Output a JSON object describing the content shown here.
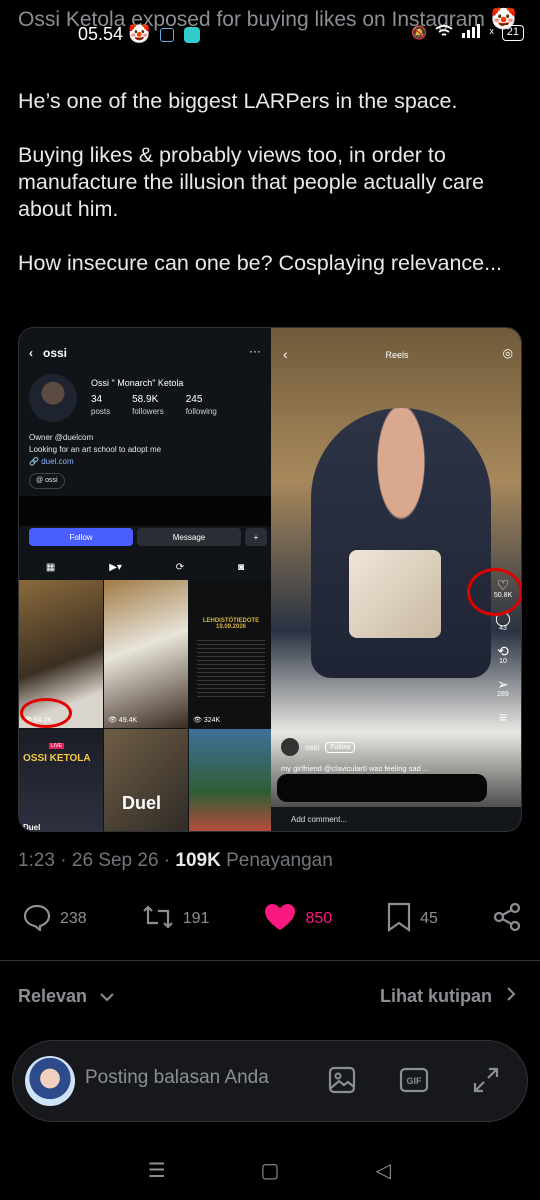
{
  "status_bar": {
    "time": "05.54",
    "battery": "21",
    "network": "ˣ"
  },
  "scrolled_title": "Ossi Ketola exposed for buying likes on Instagram 🤡",
  "tweet": {
    "text": "He’s one of the biggest LARPers in the space.\n\nBuying likes & probably views too, in order to manufacture the illusion that people actually care about him.\n\nHow insecure can one be? Cosplaying relevance..."
  },
  "instagram": {
    "username": "ossi",
    "display_name": "Ossi \" Monarch\" Ketola",
    "stats": [
      {
        "value": "34",
        "label": "posts"
      },
      {
        "value": "58.9K",
        "label": "followers"
      },
      {
        "value": "245",
        "label": "following"
      }
    ],
    "bio_line1": "Owner @duelcom",
    "bio_line2": "Looking for an art school to adopt me",
    "link": "duel.com",
    "threads_chip": "ossi",
    "follow_label": "Follow",
    "message_label": "Message",
    "grid_views": [
      "64.3K",
      "49.4K",
      "324K"
    ],
    "news_title": "LEHDISTÖTIEDOTE 19.09.2026",
    "ossi_label": "OSSI KETOLA",
    "live_label": "LIVE",
    "duel_small": "Duel",
    "duel_big": "Duel"
  },
  "reel": {
    "title": "Reels",
    "likes": "50.8K",
    "comments": "43",
    "reposts": "10",
    "shares": "289",
    "username": "ossi",
    "follow_label": "Follow",
    "caption": "my girlfriend @clavicular0 was feeling sad ...",
    "comment_placeholder": "Add comment..."
  },
  "meta": {
    "time": "1:23",
    "date": "26 Sep 26",
    "views_count": "109K",
    "views_label": "Penayangan"
  },
  "actions": {
    "replies": "238",
    "reposts": "191",
    "likes": "850",
    "bookmarks": "45"
  },
  "sort": {
    "relevan": "Relevan",
    "lihat_kutipan": "Lihat kutipan"
  },
  "reply": {
    "placeholder": "Posting balasan Anda"
  },
  "colors": {
    "like": "#f91880",
    "muted": "#71767b",
    "annotation": "#e00000"
  }
}
